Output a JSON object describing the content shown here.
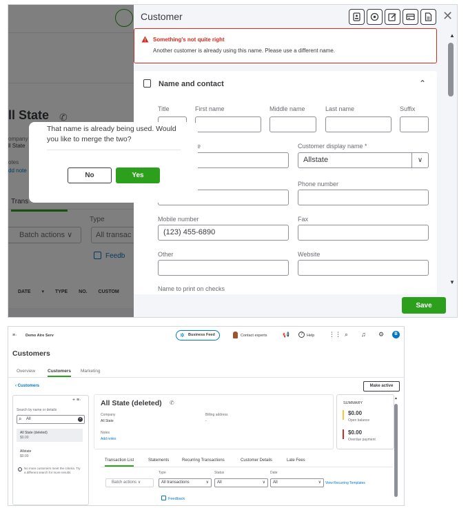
{
  "modal_view": {
    "background": {
      "customer_name": "ll State",
      "company_label": "ompany",
      "company_value": "ll State",
      "notes_label": "otes",
      "add_notes": "dd note",
      "tab": "Trans",
      "type_label": "Type",
      "batch_actions": "Batch actions",
      "all_transactions": "All transac",
      "feedback": "Feedb",
      "columns": "DATE ▾ TYPE NO. CUSTOM"
    },
    "panel": {
      "title": "Customer",
      "close": "✕",
      "error": {
        "title": "Something's not quite right",
        "message": "Another customer is already using this name. Please use a different name."
      },
      "section_title": "Name and contact",
      "labels": {
        "title": "Title",
        "first_name": "First name",
        "middle_name": "Middle name",
        "last_name": "Last name",
        "suffix": "Suffix",
        "company_partial": "e",
        "display_name": "Customer display name *",
        "phone": "Phone number",
        "mobile": "Mobile number",
        "fax": "Fax",
        "other": "Other",
        "website": "Website",
        "print_checks": "Name to print on checks"
      },
      "values": {
        "display_name": "Allstate",
        "mobile": "(123) 455-6890"
      },
      "save_label": "Save"
    },
    "merge_dialog": {
      "message": "That name is already being used. Would you like to merge the two?",
      "no_label": "No",
      "yes_label": "Yes"
    }
  },
  "full_view": {
    "topbar": {
      "company": "Demo Aire Serv",
      "business_feed": "Business Feed",
      "contact_experts": "Contact experts",
      "help": "Help",
      "avatar": "B"
    },
    "page_title": "Customers",
    "tabs": [
      "Overview",
      "Customers",
      "Marketing"
    ],
    "back_link": "Customers",
    "make_active": "Make active",
    "search": {
      "label": "Search by name or details",
      "value": "All"
    },
    "list": [
      {
        "name": "All State (deleted)",
        "balance": "$0.00"
      },
      {
        "name": "Allstate",
        "balance": "$0.00"
      }
    ],
    "no_more_note": "No more customers meet the criteria. Try a different search for more results.",
    "customer": {
      "name": "All State (deleted)",
      "company_label": "Company",
      "company_value": "All State",
      "billing_label": "Billing address",
      "billing_value": "-",
      "notes_label": "Notes",
      "add_notes": "Add notes"
    },
    "summary": {
      "title": "SUMMARY",
      "open_balance": "$0.00",
      "open_balance_label": "Open balance",
      "overdue": "$0.00",
      "overdue_label": "Overdue payment"
    },
    "sub_tabs": [
      "Transaction List",
      "Statements",
      "Recurring Transactions",
      "Customer Details",
      "Late Fees"
    ],
    "filters": {
      "batch_actions": "Batch actions",
      "type_label": "Type",
      "type_value": "All transactions",
      "status_label": "Status",
      "status_value": "All",
      "date_label": "Date",
      "date_value": "All",
      "view_recurring": "View Recurring Templates"
    },
    "feedback": "Feedback"
  },
  "colors": {
    "brand_green": "#2ca01c",
    "link_blue": "#0077c5",
    "error_red": "#d52b1e",
    "warning_yellow": "#ffc439"
  }
}
